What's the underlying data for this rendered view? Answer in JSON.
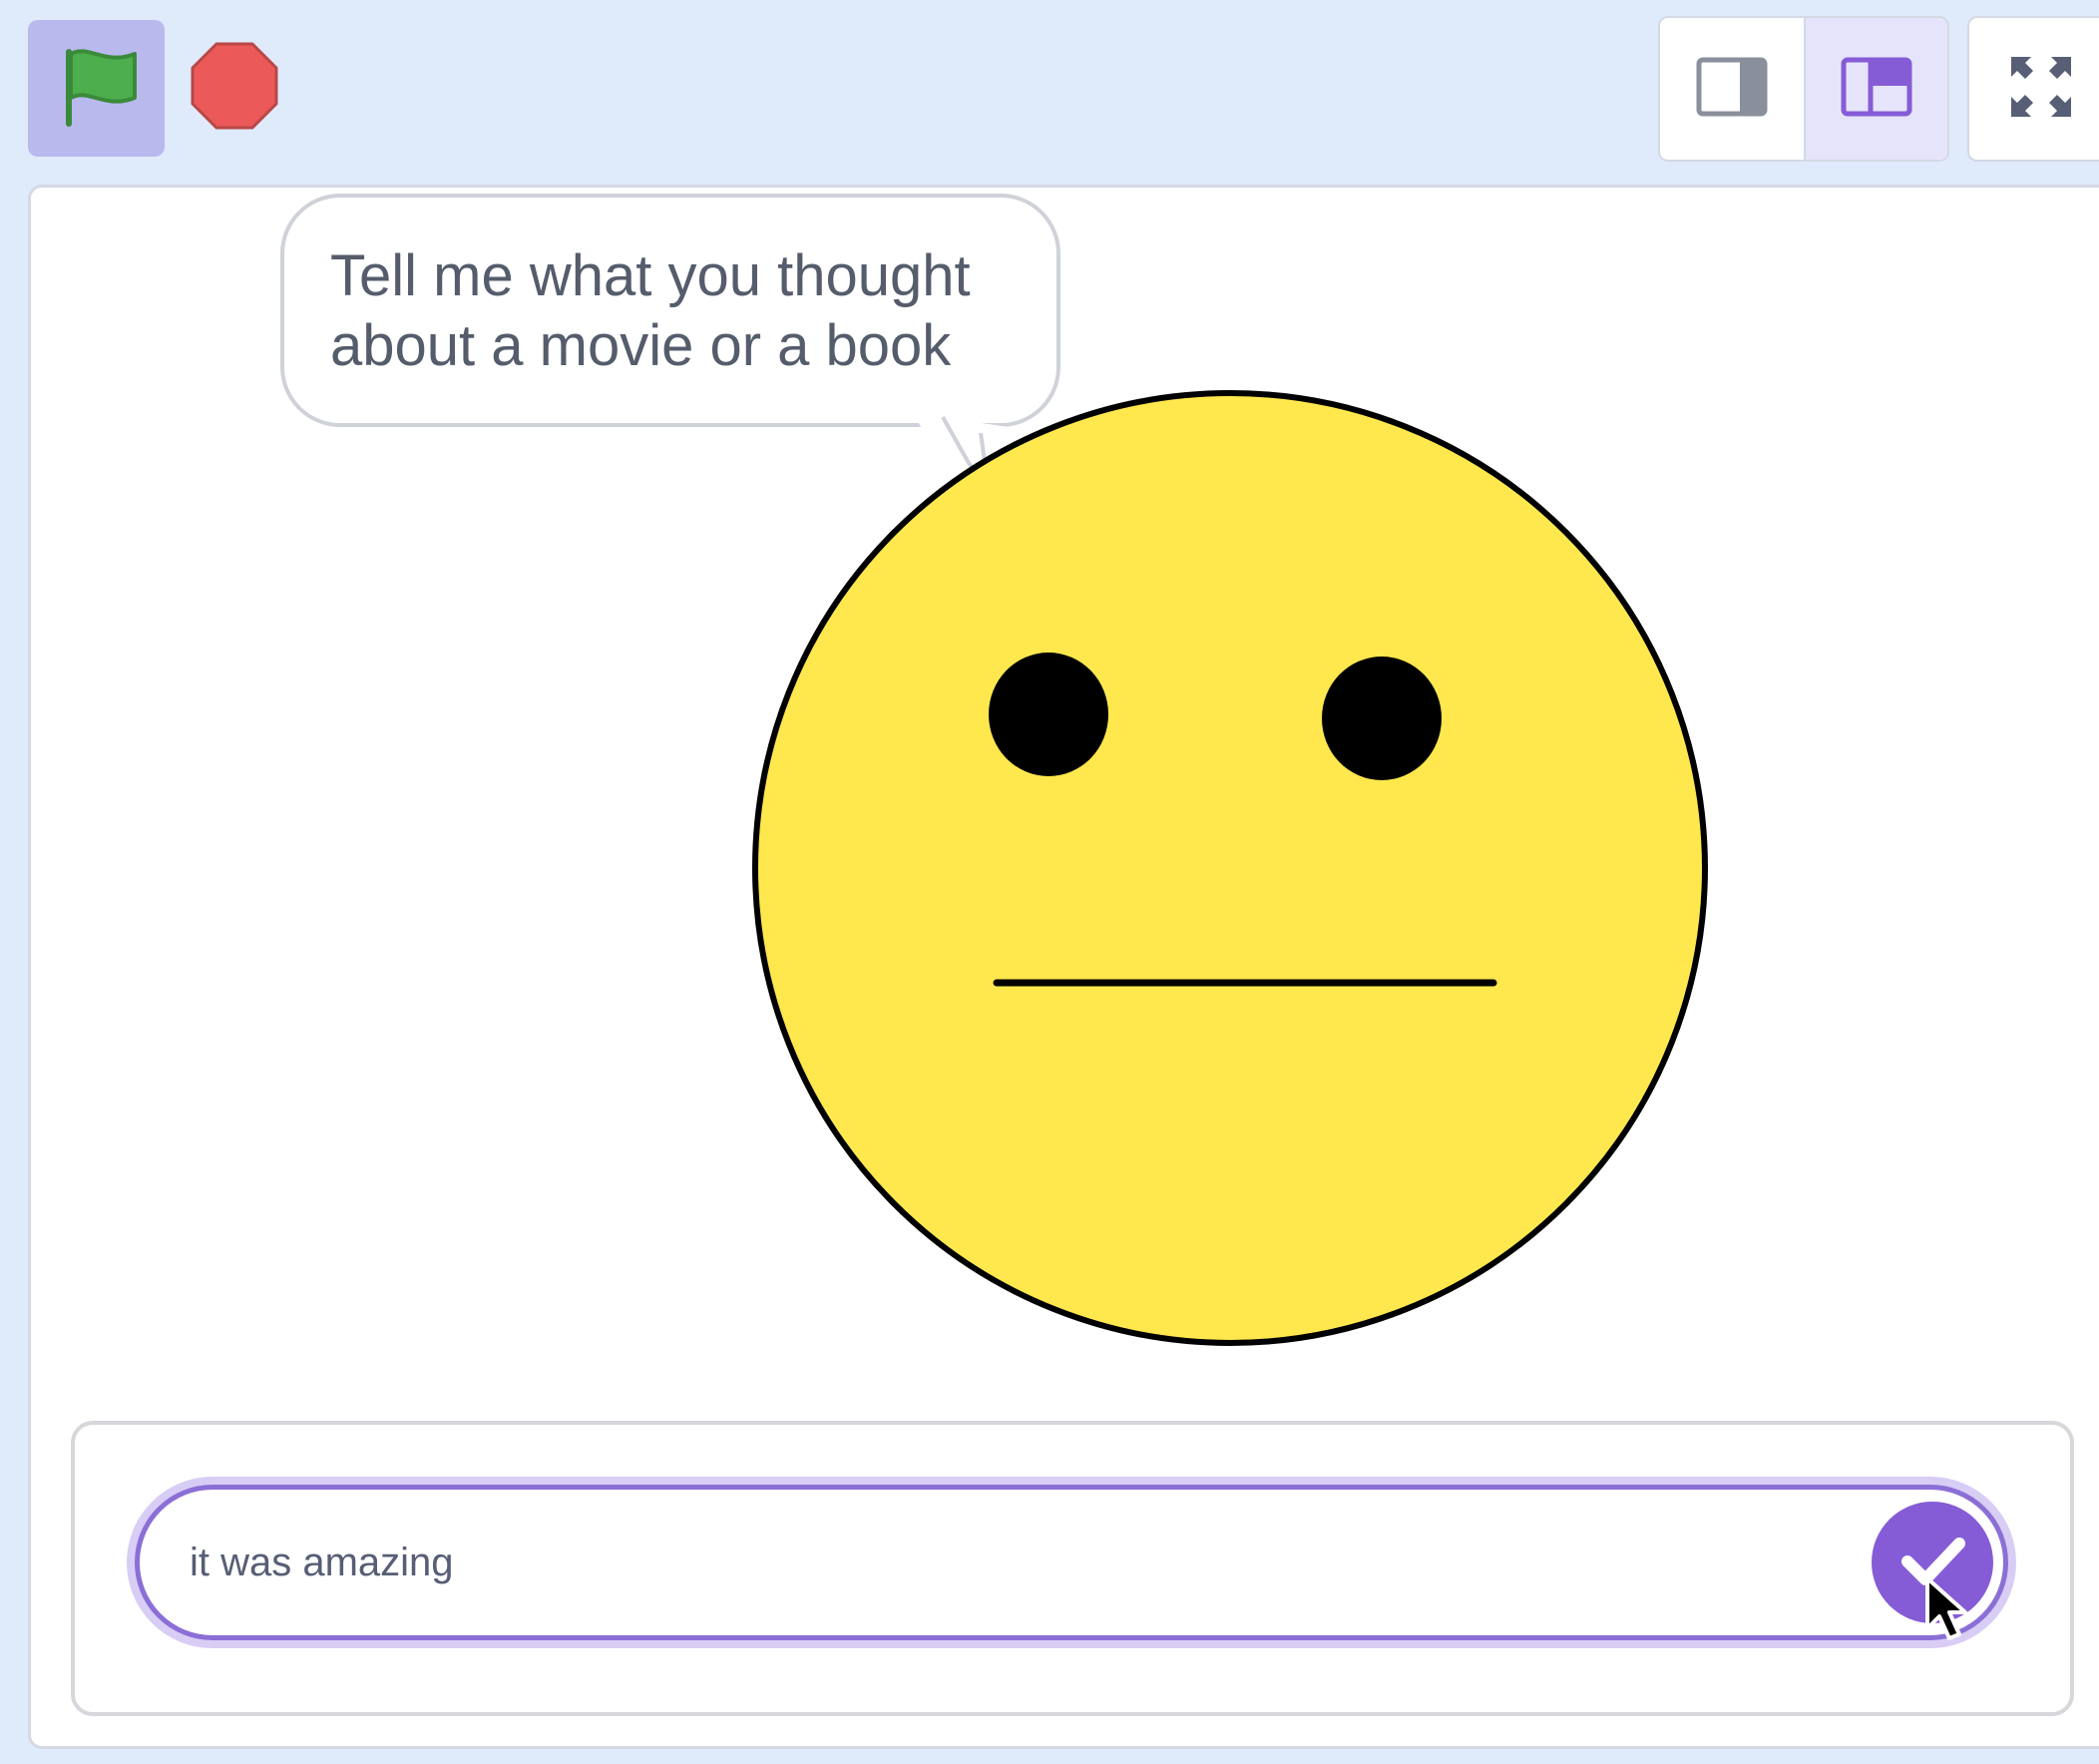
{
  "toolbar": {
    "green_flag_icon": "green-flag-icon",
    "stop_icon": "stop-sign-icon",
    "layout_small_stage_icon": "small-stage-layout-icon",
    "layout_normal_stage_icon": "normal-stage-layout-icon",
    "fullscreen_icon": "fullscreen-icon"
  },
  "stage": {
    "speech_bubble": {
      "line1": "Tell me what you thought",
      "line2": "about a movie or a book"
    },
    "sprite": {
      "name_icon": "neutral-face-icon",
      "fill": "#ffe84d",
      "outline": "#000000"
    }
  },
  "ask_prompt": {
    "answer_value": "it was amazing",
    "submit_icon": "checkmark-icon"
  },
  "colors": {
    "accent": "#855cd6",
    "toolbar_bg": "#dfeafb",
    "flag_green": "#4cae4c",
    "stop_red": "#ec5959"
  }
}
